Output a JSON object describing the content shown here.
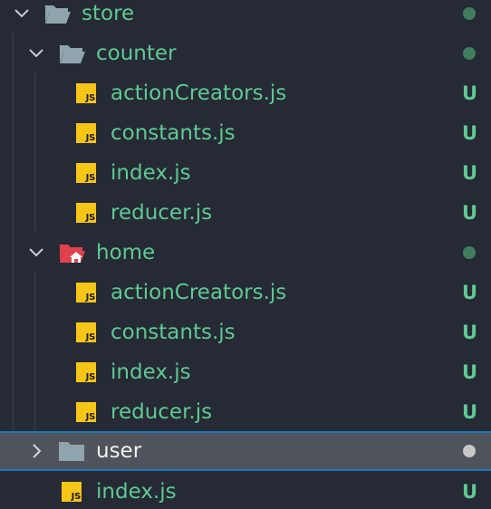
{
  "explorer": {
    "store": {
      "name": "store",
      "expanded": true,
      "badge": "dot"
    },
    "counter": {
      "name": "counter",
      "expanded": true,
      "badge": "dot",
      "files": [
        {
          "name": "actionCreators.js",
          "status": "U",
          "icon_text": "JS"
        },
        {
          "name": "constants.js",
          "status": "U",
          "icon_text": "JS"
        },
        {
          "name": "index.js",
          "status": "U",
          "icon_text": "JS"
        },
        {
          "name": "reducer.js",
          "status": "U",
          "icon_text": "JS"
        }
      ]
    },
    "home": {
      "name": "home",
      "expanded": true,
      "badge": "dot",
      "files": [
        {
          "name": "actionCreators.js",
          "status": "U",
          "icon_text": "JS"
        },
        {
          "name": "constants.js",
          "status": "U",
          "icon_text": "JS"
        },
        {
          "name": "index.js",
          "status": "U",
          "icon_text": "JS"
        },
        {
          "name": "reducer.js",
          "status": "U",
          "icon_text": "JS"
        }
      ]
    },
    "user": {
      "name": "user",
      "expanded": false,
      "selected": true,
      "badge": "dot"
    },
    "store_index": {
      "name": "index.js",
      "status": "U",
      "icon_text": "JS"
    }
  },
  "icons": {
    "folder_open": "folder-open-icon",
    "home_folder": "home-folder-icon",
    "folder_closed": "folder-icon",
    "js_file": "js-file-icon",
    "chevron_down": "chevron-down-icon",
    "chevron_right": "chevron-right-icon"
  },
  "colors": {
    "background": "#262a35",
    "untracked_text": "#5fc993",
    "selected_bg": "#4f535b",
    "selected_border": "#1e77b8",
    "js_icon": "#f5c518",
    "home_folder": "#e0424e",
    "folder": "#90a4ae"
  }
}
